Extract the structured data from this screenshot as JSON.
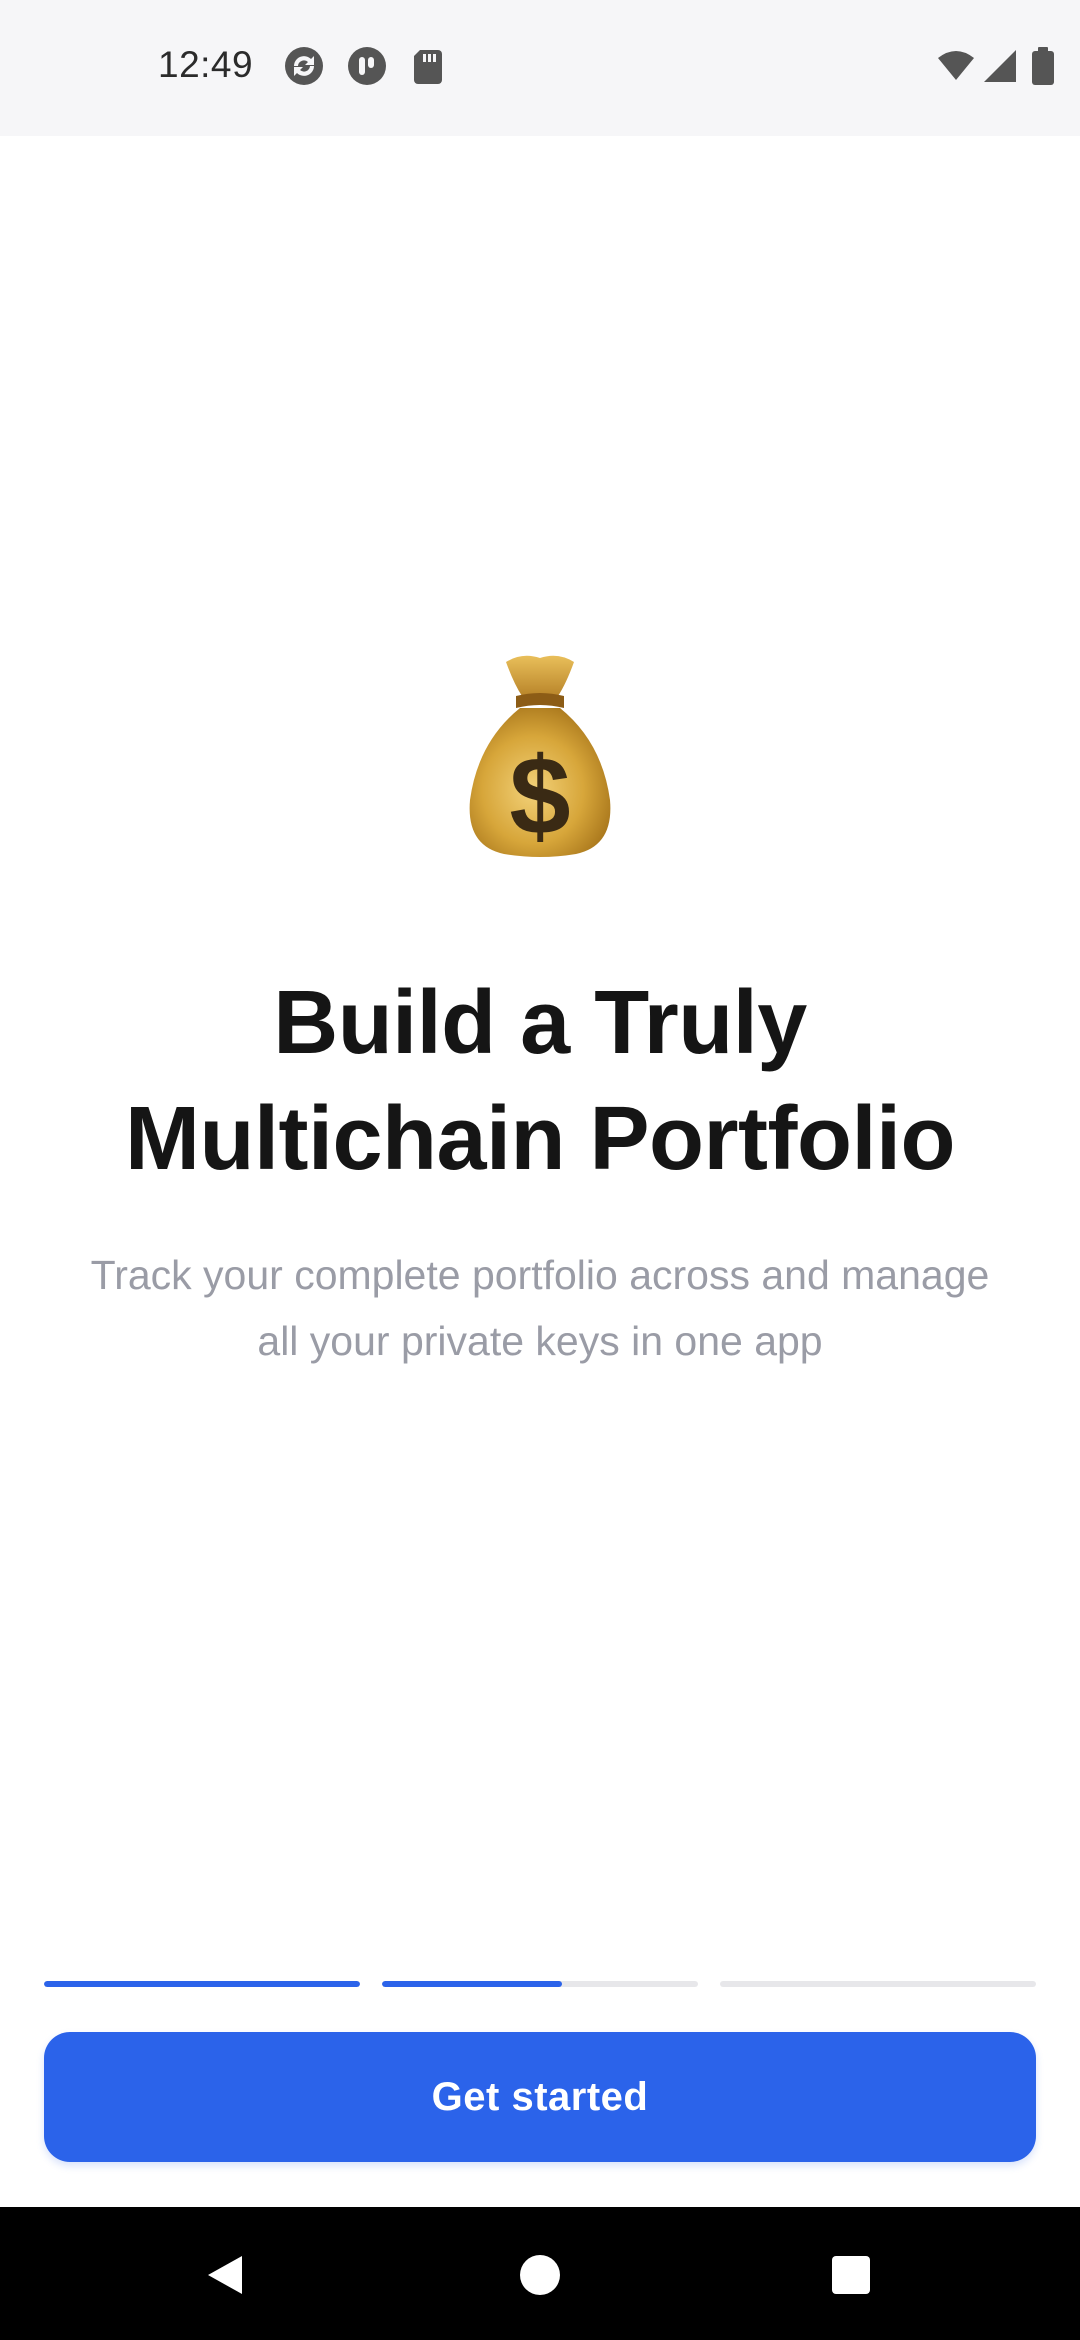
{
  "status_bar": {
    "time": "12:49",
    "left_icons": [
      "sync-icon",
      "tally-icon",
      "sd-card-icon"
    ],
    "right_icons": [
      "wifi-icon",
      "cellular-signal-icon",
      "battery-icon"
    ]
  },
  "onboarding": {
    "hero_icon": "money-bag-icon",
    "title_lines": [
      "Build a Truly",
      "Multichain Portfolio"
    ],
    "subtitle_lines": [
      "Track your complete portfolio across and manage",
      "all your private keys in one app"
    ],
    "progress": {
      "segments": [
        1.0,
        0.57,
        0.0
      ],
      "active_color": "#2b63ea",
      "track_color": "#e7e7ea"
    },
    "cta_label": "Get started"
  },
  "nav_bar": {
    "buttons": [
      "back-icon",
      "home-icon",
      "recents-icon"
    ]
  },
  "colors": {
    "accent": "#2b63ea",
    "title": "#151515",
    "subtitle": "#9a9ca6"
  }
}
